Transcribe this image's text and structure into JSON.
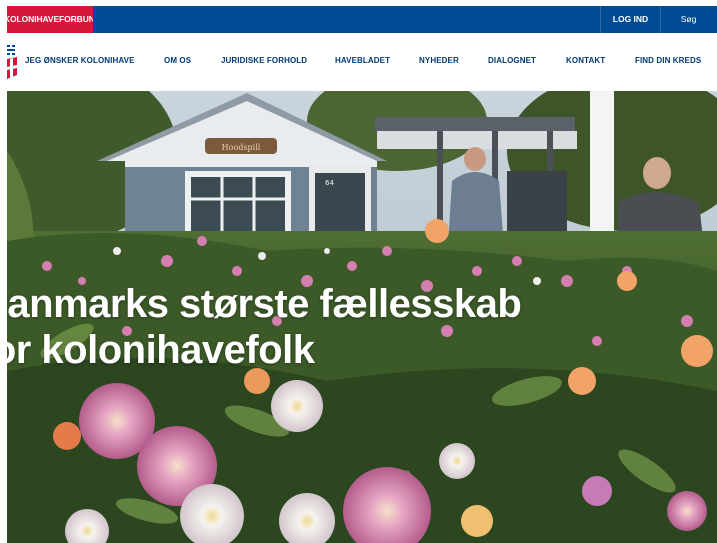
{
  "topbar": {
    "brand_label": "KOLONIHAVEFORBUNDET",
    "login_label": "LOG IND",
    "search_label": "Søg",
    "colors": {
      "blue": "#004b94",
      "red": "#d6163b"
    }
  },
  "nav": {
    "logo_icon": "flag-logo-icon",
    "items": [
      {
        "label": "JEG ØNSKER KOLONIHAVE"
      },
      {
        "label": "OM OS"
      },
      {
        "label": "JURIDISKE FORHOLD"
      },
      {
        "label": "HAVEBLADET"
      },
      {
        "label": "NYHEDER"
      },
      {
        "label": "DIALOGNET"
      },
      {
        "label": "KONTAKT"
      },
      {
        "label": "FIND DIN KREDS"
      }
    ]
  },
  "hero": {
    "headline_line1": "Danmarks største fællesskab",
    "headline_line2": "for kolonihavefolk",
    "house_number": "64",
    "house_sign": "Hoodspill"
  }
}
